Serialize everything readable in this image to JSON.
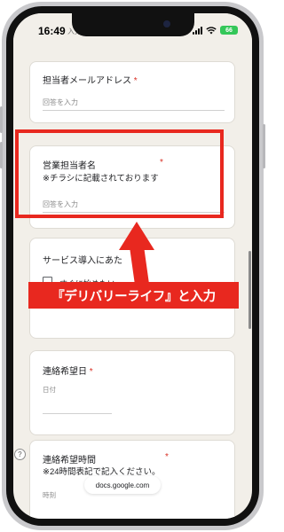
{
  "status_bar": {
    "time": "16:49",
    "sub_label": "入力",
    "battery": "66"
  },
  "form": {
    "q_email": {
      "title": "担当者メールアドレス",
      "required_mark": "*",
      "placeholder": "回答を入力"
    },
    "q_sales": {
      "title": "営業担当者名",
      "required_mark": "*",
      "note": "※チラシに記載されております",
      "placeholder": "回答を入力"
    },
    "q_intro": {
      "title": "サービス導入にあた",
      "option": "すぐに始めたい"
    },
    "q_date": {
      "title": "連絡希望日",
      "required_mark": "*",
      "field_label": "日付"
    },
    "q_time": {
      "title": "連絡希望時間",
      "required_mark": "*",
      "note": "※24時間表記で記入ください。",
      "field_label": "時刻"
    }
  },
  "annotation": {
    "callout": "『デリバリーライフ』と入力",
    "color": "#e8281f"
  },
  "browser": {
    "url": "docs.google.com",
    "help_icon": "?"
  },
  "icons": [
    "signal-icon",
    "wifi-icon",
    "battery-icon",
    "help-icon",
    "arrow-icon"
  ]
}
